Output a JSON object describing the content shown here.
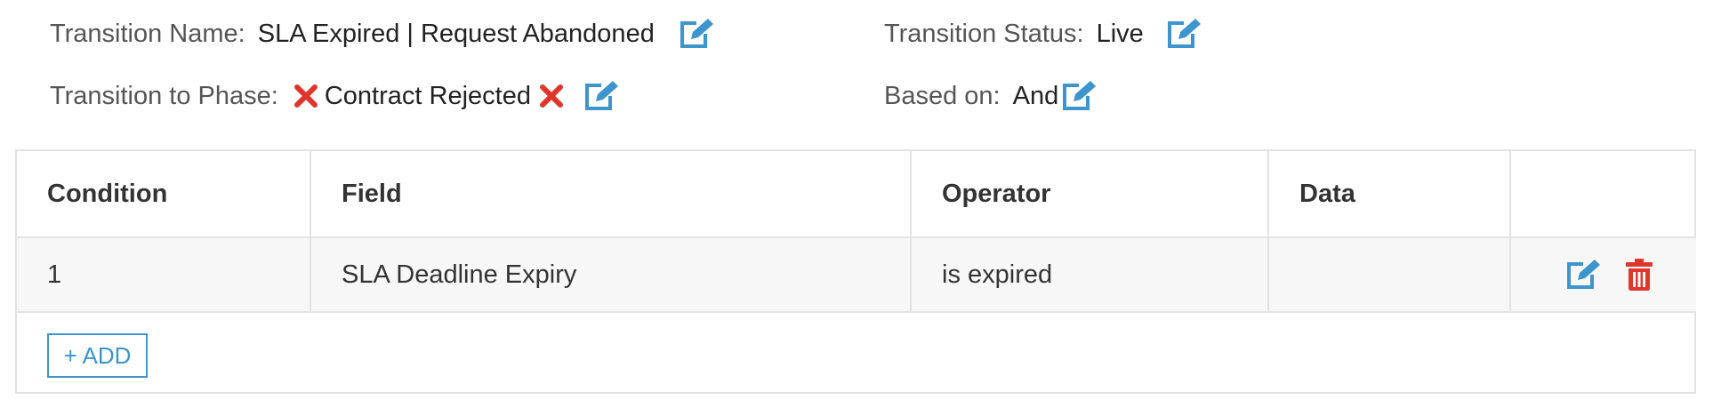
{
  "transition": {
    "name_label": "Transition Name:",
    "name_value": "SLA Expired | Request Abandoned",
    "status_label": "Transition Status:",
    "status_value": "Live",
    "phase_label": "Transition to Phase:",
    "phase_value": "Contract Rejected",
    "based_on_label": "Based on:",
    "based_on_value": "And"
  },
  "colors": {
    "accent": "#3d95cd",
    "danger": "#e0352b"
  },
  "icons": {
    "edit": "edit-icon",
    "remove": "close-x-icon",
    "delete": "trash-icon"
  },
  "table": {
    "columns": [
      "Condition",
      "Field",
      "Operator",
      "Data",
      ""
    ],
    "rows": [
      {
        "condition": "1",
        "field": "SLA Deadline Expiry",
        "operator": "is expired",
        "data": ""
      }
    ],
    "add_label": "+ ADD"
  }
}
